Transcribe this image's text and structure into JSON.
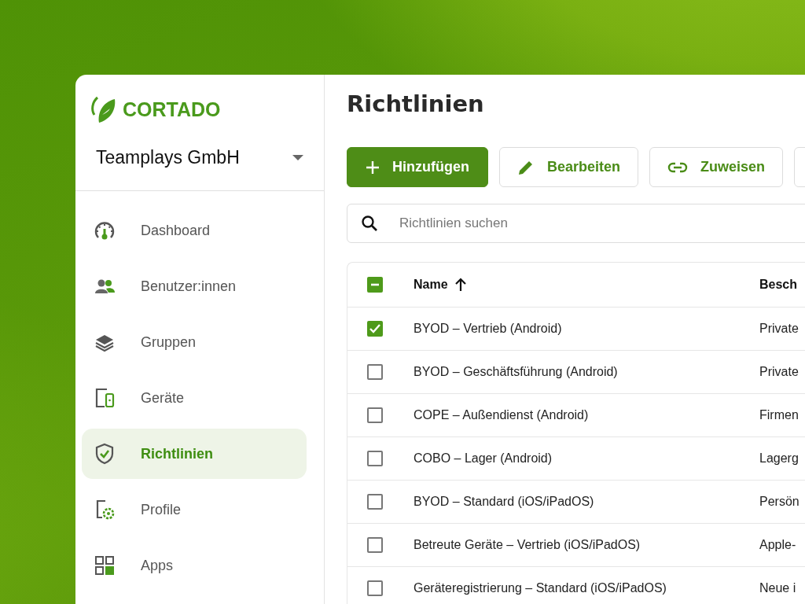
{
  "brand": "CORTADO",
  "tenant": {
    "name": "Teamplays GmbH"
  },
  "nav": [
    {
      "label": "Dashboard",
      "selected": false
    },
    {
      "label": "Benutzer:innen",
      "selected": false
    },
    {
      "label": "Gruppen",
      "selected": false
    },
    {
      "label": "Geräte",
      "selected": false
    },
    {
      "label": "Richtlinien",
      "selected": true
    },
    {
      "label": "Profile",
      "selected": false
    },
    {
      "label": "Apps",
      "selected": false
    }
  ],
  "page_title": "Richtlinien",
  "toolbar": [
    {
      "label": "Hinzufügen",
      "kind": "primary"
    },
    {
      "label": "Bearbeiten",
      "kind": "secondary"
    },
    {
      "label": "Zuweisen",
      "kind": "secondary"
    }
  ],
  "search": {
    "placeholder": "Richtlinien suchen"
  },
  "table": {
    "select_all": {
      "indeterminate": true
    },
    "columns": [
      {
        "label": "Name"
      },
      {
        "label": "Besch"
      }
    ],
    "rows": [
      {
        "name": "BYOD – Vertrieb (Android)",
        "column_2": "Private",
        "selected": true
      },
      {
        "name": "BYOD – Geschäftsführung (Android)",
        "column_2": "Private",
        "selected": false
      },
      {
        "name": "COPE – Außendienst (Android)",
        "column_2": "Firmen",
        "selected": false
      },
      {
        "name": "COBO – Lager (Android)",
        "column_2": "Lagerg",
        "selected": false
      },
      {
        "name": "BYOD – Standard (iOS/iPadOS)",
        "column_2": "Persön",
        "selected": false
      },
      {
        "name": "Betreute Geräte – Vertrieb (iOS/iPadOS)",
        "column_2": "Apple-",
        "selected": false
      },
      {
        "name": "Geräteregistrierung – Standard (iOS/iPadOS)",
        "column_2": "Neue i",
        "selected": false
      }
    ]
  }
}
